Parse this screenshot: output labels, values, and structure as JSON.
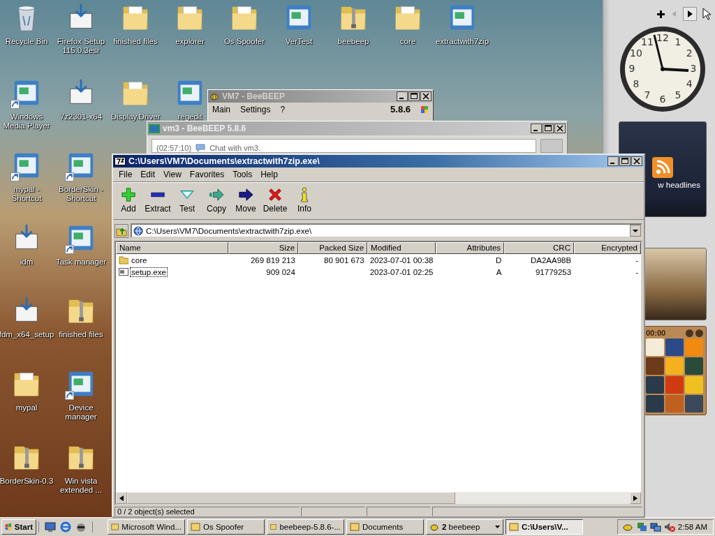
{
  "desktop": {
    "icons": [
      {
        "label": "Recycle Bin",
        "kind": "bin",
        "shortcut": false
      },
      {
        "label": "Firefox Setup 115.0.3esr",
        "kind": "installer",
        "shortcut": false
      },
      {
        "label": "finished files",
        "kind": "folder",
        "shortcut": false
      },
      {
        "label": "explorer",
        "kind": "folder",
        "shortcut": false
      },
      {
        "label": "Os Spoofer",
        "kind": "folder",
        "shortcut": false
      },
      {
        "label": "VerTest",
        "kind": "app",
        "shortcut": false
      },
      {
        "label": "beebeep",
        "kind": "zip",
        "shortcut": false
      },
      {
        "label": "core",
        "kind": "folder",
        "shortcut": false
      },
      {
        "label": "extractwith7zip",
        "kind": "app",
        "shortcut": false
      },
      {
        "label": "Windows Media Player",
        "kind": "app",
        "shortcut": true
      },
      {
        "label": "7z2301-x64",
        "kind": "installer",
        "shortcut": false
      },
      {
        "label": "Display.Driver",
        "kind": "folder",
        "shortcut": false
      },
      {
        "label": "regedit",
        "kind": "app",
        "shortcut": false
      },
      {
        "label": "mypal - Shortcut",
        "kind": "app",
        "shortcut": true
      },
      {
        "label": "BorderSkin - Shortcut",
        "kind": "app",
        "shortcut": true
      },
      {
        "label": "idm",
        "kind": "installer",
        "shortcut": false
      },
      {
        "label": "Task manager",
        "kind": "app",
        "shortcut": true
      },
      {
        "label": "fdm_x64_setup",
        "kind": "installer",
        "shortcut": false
      },
      {
        "label": "finished files",
        "kind": "zip",
        "shortcut": false
      },
      {
        "label": "mypal",
        "kind": "folder",
        "shortcut": false
      },
      {
        "label": "Device manager",
        "kind": "app",
        "shortcut": true
      },
      {
        "label": "BorderSkin-0.3",
        "kind": "zip",
        "shortcut": false
      },
      {
        "label": "Win vista extended ...",
        "kind": "zip",
        "shortcut": false
      }
    ]
  },
  "sidebar": {
    "clock_numerals": [
      "11",
      "12",
      "1",
      "10",
      "2",
      "9",
      "3",
      "8",
      "4",
      "7",
      "5",
      "6"
    ],
    "headlines_gadget": {
      "text": "w headlines"
    },
    "puzzle_gadget": {
      "timer": "00:00"
    }
  },
  "beebeep_main_window": {
    "title": "VM7 - BeeBEEP",
    "active": false,
    "menu": [
      "Main",
      "Settings",
      "?"
    ],
    "version": "5.8.6"
  },
  "beebeep_chat_window": {
    "title": "vm3 - BeeBEEP 5.8.6",
    "active": false,
    "chat": [
      {
        "time": "(02:57:10)",
        "text": "Chat with vm3."
      }
    ]
  },
  "archive_window": {
    "title": "C:\\Users\\VM7\\Documents\\extractwith7zip.exe\\",
    "active": true,
    "menu": [
      "File",
      "Edit",
      "View",
      "Favorites",
      "Tools",
      "Help"
    ],
    "toolbar": [
      {
        "label": "Add",
        "kind": "add"
      },
      {
        "label": "Extract",
        "kind": "extract"
      },
      {
        "label": "Test",
        "kind": "test"
      },
      {
        "label": "Copy",
        "kind": "copy"
      },
      {
        "label": "Move",
        "kind": "move"
      },
      {
        "label": "Delete",
        "kind": "delete"
      },
      {
        "label": "Info",
        "kind": "info"
      }
    ],
    "address": "C:\\Users\\VM7\\Documents\\extractwith7zip.exe\\",
    "columns": [
      "Name",
      "Size",
      "Packed Size",
      "Modified",
      "Attributes",
      "CRC",
      "Encrypted"
    ],
    "rows": [
      {
        "kind": "folder",
        "name": "core",
        "size": "269 819 213",
        "packed_size": "80 901 673",
        "modified": "2023-07-01 00:38",
        "attributes": "D",
        "crc": "DA2AA98B",
        "encrypted": "-",
        "selected": false,
        "focused": false
      },
      {
        "kind": "file",
        "name": "setup.exe",
        "size": "909 024",
        "modified": "2023-07-01 02:25",
        "attributes": "A",
        "crc": "91779253",
        "encrypted": "-",
        "selected": false,
        "focused": true
      }
    ],
    "status_bar": [
      "0 / 2 object(s) selected"
    ]
  },
  "taskbar": {
    "start": "Start",
    "tasks": [
      {
        "label": "Microsoft Wind...",
        "kind": "single",
        "selected": false
      },
      {
        "label": "Os Spoofer",
        "kind": "single",
        "selected": false
      },
      {
        "label": "beebeep-5.8.6-...",
        "kind": "single",
        "selected": false
      },
      {
        "label": "Documents",
        "kind": "single",
        "selected": false
      },
      {
        "label": "**2** beebeep",
        "kind": "group",
        "selected": false
      },
      {
        "label": "C:\\Users\\V...",
        "kind": "single",
        "selected": true
      }
    ],
    "clock": "2:58 AM"
  }
}
